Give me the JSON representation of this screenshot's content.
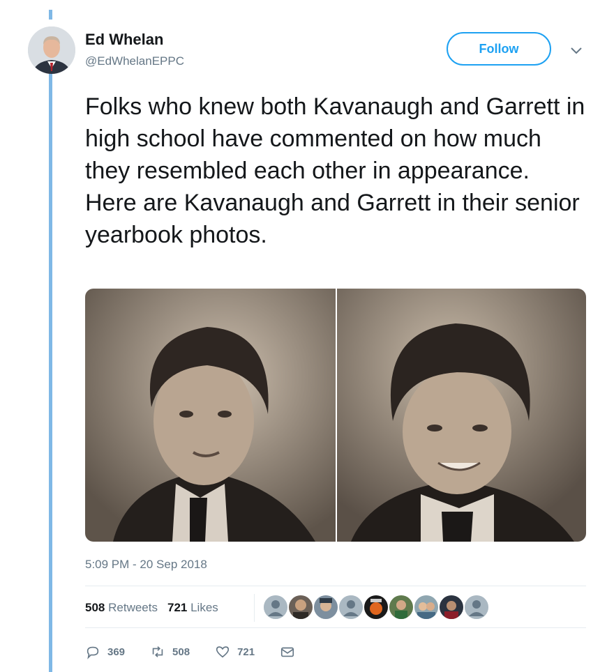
{
  "author": {
    "name": "Ed Whelan",
    "handle": "@EdWhelanEPPC"
  },
  "follow_label": "Follow",
  "tweet": {
    "text": "Folks who knew both Kavanaugh and Garrett in high school have commented on how much they resembled each other in appearance. Here are Kavanaugh and Garrett in their senior yearbook photos.",
    "timestamp": "5:09 PM - 20 Sep 2018"
  },
  "stats": {
    "retweets_count": "508",
    "retweets_label": "Retweets",
    "likes_count": "721",
    "likes_label": "Likes"
  },
  "actions": {
    "reply_count": "369",
    "retweet_count": "508",
    "like_count": "721"
  },
  "icons": {
    "caret": "chevron-down-icon",
    "reply": "reply-icon",
    "retweet": "retweet-icon",
    "like": "heart-icon",
    "dm": "envelope-icon"
  },
  "colors": {
    "accent": "#1da1f2",
    "thread_line": "#7fb8e6",
    "muted": "#657786"
  }
}
